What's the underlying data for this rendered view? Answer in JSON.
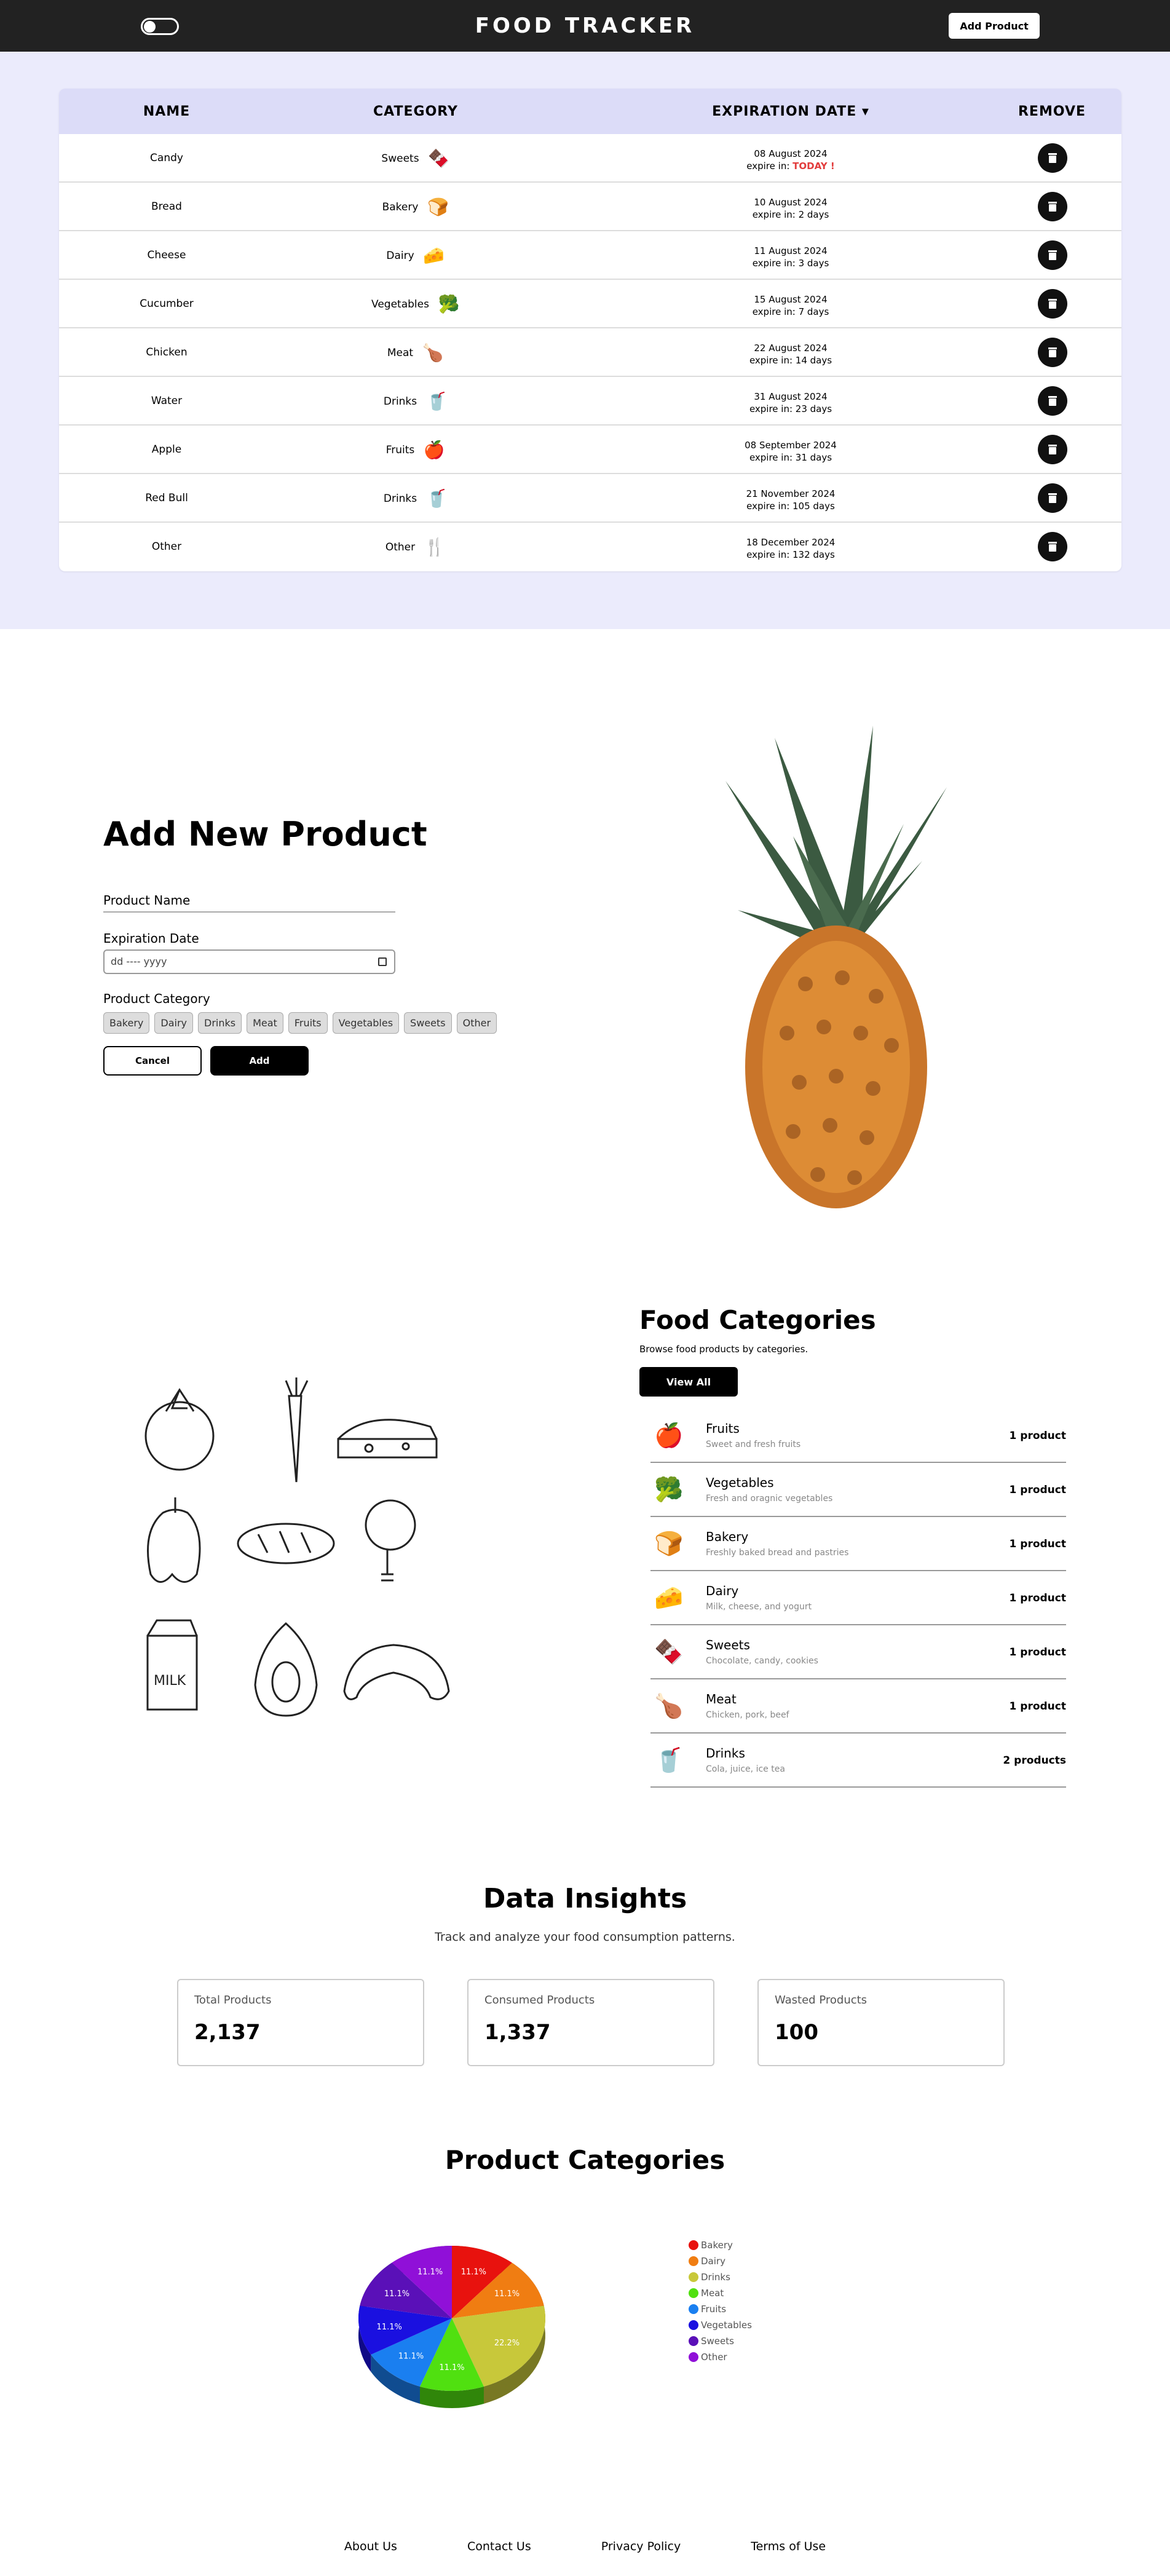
{
  "header": {
    "logo": "FOOD TRACKER",
    "add_product_label": "Add Product"
  },
  "table": {
    "columns": [
      "NAME",
      "CATEGORY",
      "EXPIRATION DATE ▾",
      "REMOVE"
    ],
    "rows": [
      {
        "name": "Candy",
        "category": "Sweets",
        "date": "08 August 2024",
        "expire": "expire in: ",
        "expire_value": "TODAY !",
        "emoji": "🍫"
      },
      {
        "name": "Bread",
        "category": "Bakery",
        "date": "10 August 2024",
        "expire": "expire in: 2 days",
        "emoji": "🍞"
      },
      {
        "name": "Cheese",
        "category": "Dairy",
        "date": "11 August 2024",
        "expire": "expire in: 3 days",
        "emoji": "🧀"
      },
      {
        "name": "Cucumber",
        "category": "Vegetables",
        "date": "15 August 2024",
        "expire": "expire in: 7 days",
        "emoji": "🥦"
      },
      {
        "name": "Chicken",
        "category": "Meat",
        "date": "22 August 2024",
        "expire": "expire in: 14 days",
        "emoji": "🍗"
      },
      {
        "name": "Water",
        "category": "Drinks",
        "date": "31 August 2024",
        "expire": "expire in: 23 days",
        "emoji": "🥤"
      },
      {
        "name": "Apple",
        "category": "Fruits",
        "date": "08 September 2024",
        "expire": "expire in: 31 days",
        "emoji": "🍎"
      },
      {
        "name": "Red Bull",
        "category": "Drinks",
        "date": "21 November 2024",
        "expire": "expire in: 105 days",
        "emoji": "🥤"
      },
      {
        "name": "Other",
        "category": "Other",
        "date": "18 December 2024",
        "expire": "expire in: 132 days",
        "emoji": "🍴"
      }
    ]
  },
  "form": {
    "title": "Add New Product",
    "name_label": "Product Name",
    "date_label": "Expiration Date",
    "date_placeholder": "dd ---- yyyy",
    "category_label": "Product Category",
    "categories": [
      "Bakery",
      "Dairy",
      "Drinks",
      "Meat",
      "Fruits",
      "Vegetables",
      "Sweets",
      "Other"
    ],
    "cancel_label": "Cancel",
    "add_label": "Add"
  },
  "food_categories": {
    "title": "Food Categories",
    "subtitle": "Browse food products by categories.",
    "view_all_label": "View All",
    "items": [
      {
        "title": "Fruits",
        "desc": "Sweet and fresh fruits",
        "count": "1 product",
        "emoji": "🍎"
      },
      {
        "title": "Vegetables",
        "desc": "Fresh and oragnic vegetables",
        "count": "1 product",
        "emoji": "🥦"
      },
      {
        "title": "Bakery",
        "desc": "Freshly baked bread and pastries",
        "count": "1 product",
        "emoji": "🍞"
      },
      {
        "title": "Dairy",
        "desc": "Milk, cheese, and yogurt",
        "count": "1 product",
        "emoji": "🧀"
      },
      {
        "title": "Sweets",
        "desc": "Chocolate, candy, cookies",
        "count": "1 product",
        "emoji": "🍫"
      },
      {
        "title": "Meat",
        "desc": "Chicken, pork, beef",
        "count": "1 product",
        "emoji": "🍗"
      },
      {
        "title": "Drinks",
        "desc": "Cola, juice, ice tea",
        "count": "2 products",
        "emoji": "🥤"
      }
    ]
  },
  "insights": {
    "title": "Data Insights",
    "subtitle": "Track and analyze your food consumption patterns.",
    "cards": [
      {
        "label": "Total Products",
        "value": "2,137"
      },
      {
        "label": "Consumed Products",
        "value": "1,337"
      },
      {
        "label": "Wasted Products",
        "value": "100"
      }
    ]
  },
  "chart_title": "Product Categories",
  "chart_data": {
    "type": "pie",
    "title": "",
    "slices": [
      {
        "name": "Bakery",
        "value": 11.1,
        "label": "11.1%",
        "color": "#e8120e"
      },
      {
        "name": "Dairy",
        "value": 11.1,
        "label": "11.1%",
        "color": "#f07d12"
      },
      {
        "name": "Drinks",
        "value": 22.2,
        "label": "22.2%",
        "color": "#c8c83a"
      },
      {
        "name": "Meat",
        "value": 11.1,
        "label": "11.1%",
        "color": "#50e010"
      },
      {
        "name": "Fruits",
        "value": 11.1,
        "label": "11.1%",
        "color": "#1a7ff0"
      },
      {
        "name": "Vegetables",
        "value": 11.1,
        "label": "11.1%",
        "color": "#1a10e0"
      },
      {
        "name": "Sweets",
        "value": 11.1,
        "label": "11.1%",
        "color": "#5a10b8"
      },
      {
        "name": "Other",
        "value": 11.1,
        "label": "11.1%",
        "color": "#9010d8"
      }
    ],
    "legend_placement": "right"
  },
  "footer": {
    "links": [
      "About Us",
      "Contact Us",
      "Privacy Policy",
      "Terms of Use"
    ]
  }
}
